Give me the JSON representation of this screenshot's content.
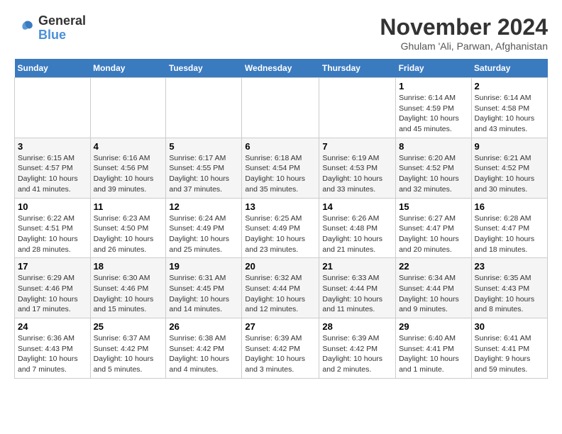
{
  "logo": {
    "line1": "General",
    "line2": "Blue"
  },
  "title": "November 2024",
  "location": "Ghulam 'Ali, Parwan, Afghanistan",
  "weekdays": [
    "Sunday",
    "Monday",
    "Tuesday",
    "Wednesday",
    "Thursday",
    "Friday",
    "Saturday"
  ],
  "weeks": [
    {
      "days": [
        {
          "date": "",
          "info": ""
        },
        {
          "date": "",
          "info": ""
        },
        {
          "date": "",
          "info": ""
        },
        {
          "date": "",
          "info": ""
        },
        {
          "date": "",
          "info": ""
        },
        {
          "date": "1",
          "info": "Sunrise: 6:14 AM\nSunset: 4:59 PM\nDaylight: 10 hours\nand 45 minutes."
        },
        {
          "date": "2",
          "info": "Sunrise: 6:14 AM\nSunset: 4:58 PM\nDaylight: 10 hours\nand 43 minutes."
        }
      ]
    },
    {
      "days": [
        {
          "date": "3",
          "info": "Sunrise: 6:15 AM\nSunset: 4:57 PM\nDaylight: 10 hours\nand 41 minutes."
        },
        {
          "date": "4",
          "info": "Sunrise: 6:16 AM\nSunset: 4:56 PM\nDaylight: 10 hours\nand 39 minutes."
        },
        {
          "date": "5",
          "info": "Sunrise: 6:17 AM\nSunset: 4:55 PM\nDaylight: 10 hours\nand 37 minutes."
        },
        {
          "date": "6",
          "info": "Sunrise: 6:18 AM\nSunset: 4:54 PM\nDaylight: 10 hours\nand 35 minutes."
        },
        {
          "date": "7",
          "info": "Sunrise: 6:19 AM\nSunset: 4:53 PM\nDaylight: 10 hours\nand 33 minutes."
        },
        {
          "date": "8",
          "info": "Sunrise: 6:20 AM\nSunset: 4:52 PM\nDaylight: 10 hours\nand 32 minutes."
        },
        {
          "date": "9",
          "info": "Sunrise: 6:21 AM\nSunset: 4:52 PM\nDaylight: 10 hours\nand 30 minutes."
        }
      ]
    },
    {
      "days": [
        {
          "date": "10",
          "info": "Sunrise: 6:22 AM\nSunset: 4:51 PM\nDaylight: 10 hours\nand 28 minutes."
        },
        {
          "date": "11",
          "info": "Sunrise: 6:23 AM\nSunset: 4:50 PM\nDaylight: 10 hours\nand 26 minutes."
        },
        {
          "date": "12",
          "info": "Sunrise: 6:24 AM\nSunset: 4:49 PM\nDaylight: 10 hours\nand 25 minutes."
        },
        {
          "date": "13",
          "info": "Sunrise: 6:25 AM\nSunset: 4:49 PM\nDaylight: 10 hours\nand 23 minutes."
        },
        {
          "date": "14",
          "info": "Sunrise: 6:26 AM\nSunset: 4:48 PM\nDaylight: 10 hours\nand 21 minutes."
        },
        {
          "date": "15",
          "info": "Sunrise: 6:27 AM\nSunset: 4:47 PM\nDaylight: 10 hours\nand 20 minutes."
        },
        {
          "date": "16",
          "info": "Sunrise: 6:28 AM\nSunset: 4:47 PM\nDaylight: 10 hours\nand 18 minutes."
        }
      ]
    },
    {
      "days": [
        {
          "date": "17",
          "info": "Sunrise: 6:29 AM\nSunset: 4:46 PM\nDaylight: 10 hours\nand 17 minutes."
        },
        {
          "date": "18",
          "info": "Sunrise: 6:30 AM\nSunset: 4:46 PM\nDaylight: 10 hours\nand 15 minutes."
        },
        {
          "date": "19",
          "info": "Sunrise: 6:31 AM\nSunset: 4:45 PM\nDaylight: 10 hours\nand 14 minutes."
        },
        {
          "date": "20",
          "info": "Sunrise: 6:32 AM\nSunset: 4:44 PM\nDaylight: 10 hours\nand 12 minutes."
        },
        {
          "date": "21",
          "info": "Sunrise: 6:33 AM\nSunset: 4:44 PM\nDaylight: 10 hours\nand 11 minutes."
        },
        {
          "date": "22",
          "info": "Sunrise: 6:34 AM\nSunset: 4:44 PM\nDaylight: 10 hours\nand 9 minutes."
        },
        {
          "date": "23",
          "info": "Sunrise: 6:35 AM\nSunset: 4:43 PM\nDaylight: 10 hours\nand 8 minutes."
        }
      ]
    },
    {
      "days": [
        {
          "date": "24",
          "info": "Sunrise: 6:36 AM\nSunset: 4:43 PM\nDaylight: 10 hours\nand 7 minutes."
        },
        {
          "date": "25",
          "info": "Sunrise: 6:37 AM\nSunset: 4:42 PM\nDaylight: 10 hours\nand 5 minutes."
        },
        {
          "date": "26",
          "info": "Sunrise: 6:38 AM\nSunset: 4:42 PM\nDaylight: 10 hours\nand 4 minutes."
        },
        {
          "date": "27",
          "info": "Sunrise: 6:39 AM\nSunset: 4:42 PM\nDaylight: 10 hours\nand 3 minutes."
        },
        {
          "date": "28",
          "info": "Sunrise: 6:39 AM\nSunset: 4:42 PM\nDaylight: 10 hours\nand 2 minutes."
        },
        {
          "date": "29",
          "info": "Sunrise: 6:40 AM\nSunset: 4:41 PM\nDaylight: 10 hours\nand 1 minute."
        },
        {
          "date": "30",
          "info": "Sunrise: 6:41 AM\nSunset: 4:41 PM\nDaylight: 9 hours\nand 59 minutes."
        }
      ]
    }
  ]
}
